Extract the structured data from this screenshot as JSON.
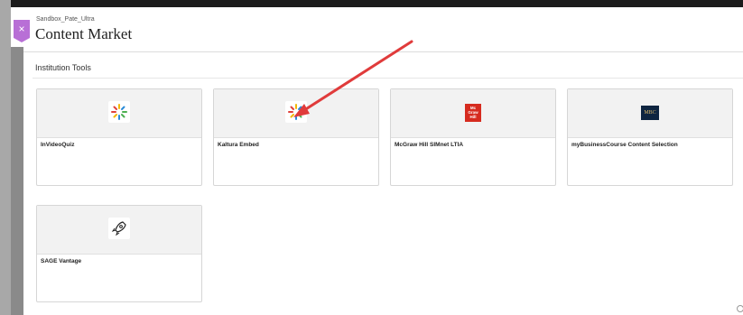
{
  "header": {
    "course_name": "Sandbox_Pate_Ultra",
    "title": "Content Market",
    "close_label": "×"
  },
  "section_title": "Institution Tools",
  "tools": [
    {
      "name": "InVideoQuiz",
      "icon": "sparkle-icon"
    },
    {
      "name": "Kaltura Embed",
      "icon": "sparkle-icon"
    },
    {
      "name": "McGraw Hill SIMnet LTIA",
      "icon": "mcgraw-hill-logo",
      "logo_text": "Mc\nGraw\nHill"
    },
    {
      "name": "myBusinessCourse Content Selection",
      "icon": "mbc-logo",
      "logo_text": "MBC"
    },
    {
      "name": "SAGE Vantage",
      "icon": "rocket-icon"
    }
  ],
  "colors": {
    "close_tab": "#b86fd6",
    "arrow": "#e03b3b",
    "mcgraw": "#d62b1f",
    "mbc": "#0e2540"
  }
}
